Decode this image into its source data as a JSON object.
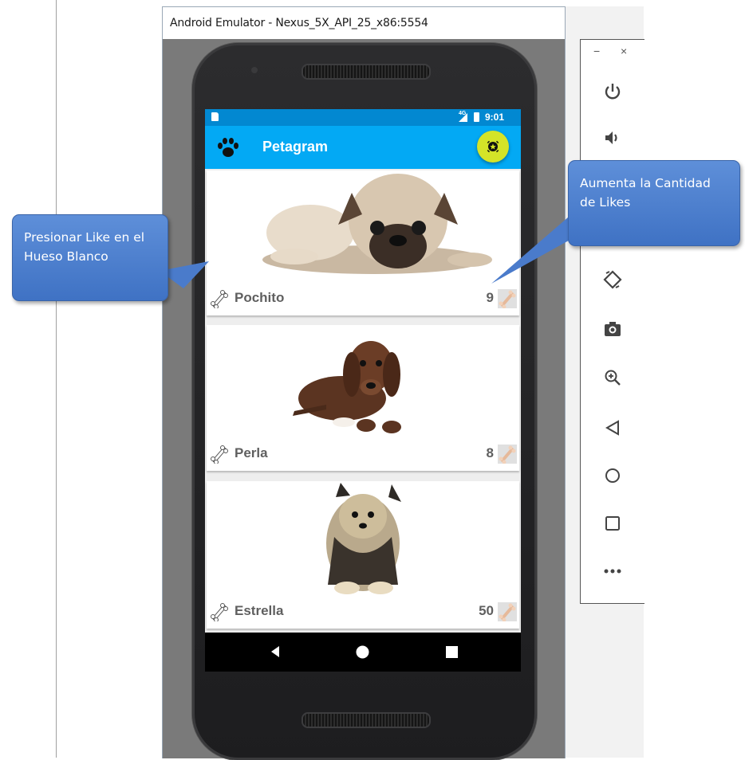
{
  "window": {
    "title": "Android Emulator - Nexus_5X_API_25_x86:5554"
  },
  "status_bar": {
    "network": "4G",
    "time": "9:01"
  },
  "app": {
    "title": "Petagram",
    "fab_icon": "star-icon",
    "brand_color": "#03a9f4",
    "status_color": "#0288d1",
    "fab_color": "#d4e428"
  },
  "pets": [
    {
      "name": "Pochito",
      "likes": "9"
    },
    {
      "name": "Perla",
      "likes": "8"
    },
    {
      "name": "Estrella",
      "likes": "50"
    }
  ],
  "nav": {
    "back": "back-icon",
    "home": "home-icon",
    "recents": "recents-icon"
  },
  "emulator_controls": [
    {
      "name": "power-icon"
    },
    {
      "name": "volume-up-icon"
    },
    {
      "name": "volume-down-icon"
    },
    {
      "name": "rotate-left-icon"
    },
    {
      "name": "rotate-right-icon"
    },
    {
      "name": "camera-icon"
    },
    {
      "name": "zoom-icon"
    },
    {
      "name": "back-icon"
    },
    {
      "name": "home-icon"
    },
    {
      "name": "overview-icon"
    },
    {
      "name": "more-icon"
    }
  ],
  "callouts": {
    "left": "Presionar Like en el Hueso Blanco",
    "right": "Aumenta la Cantidad de Likes"
  }
}
